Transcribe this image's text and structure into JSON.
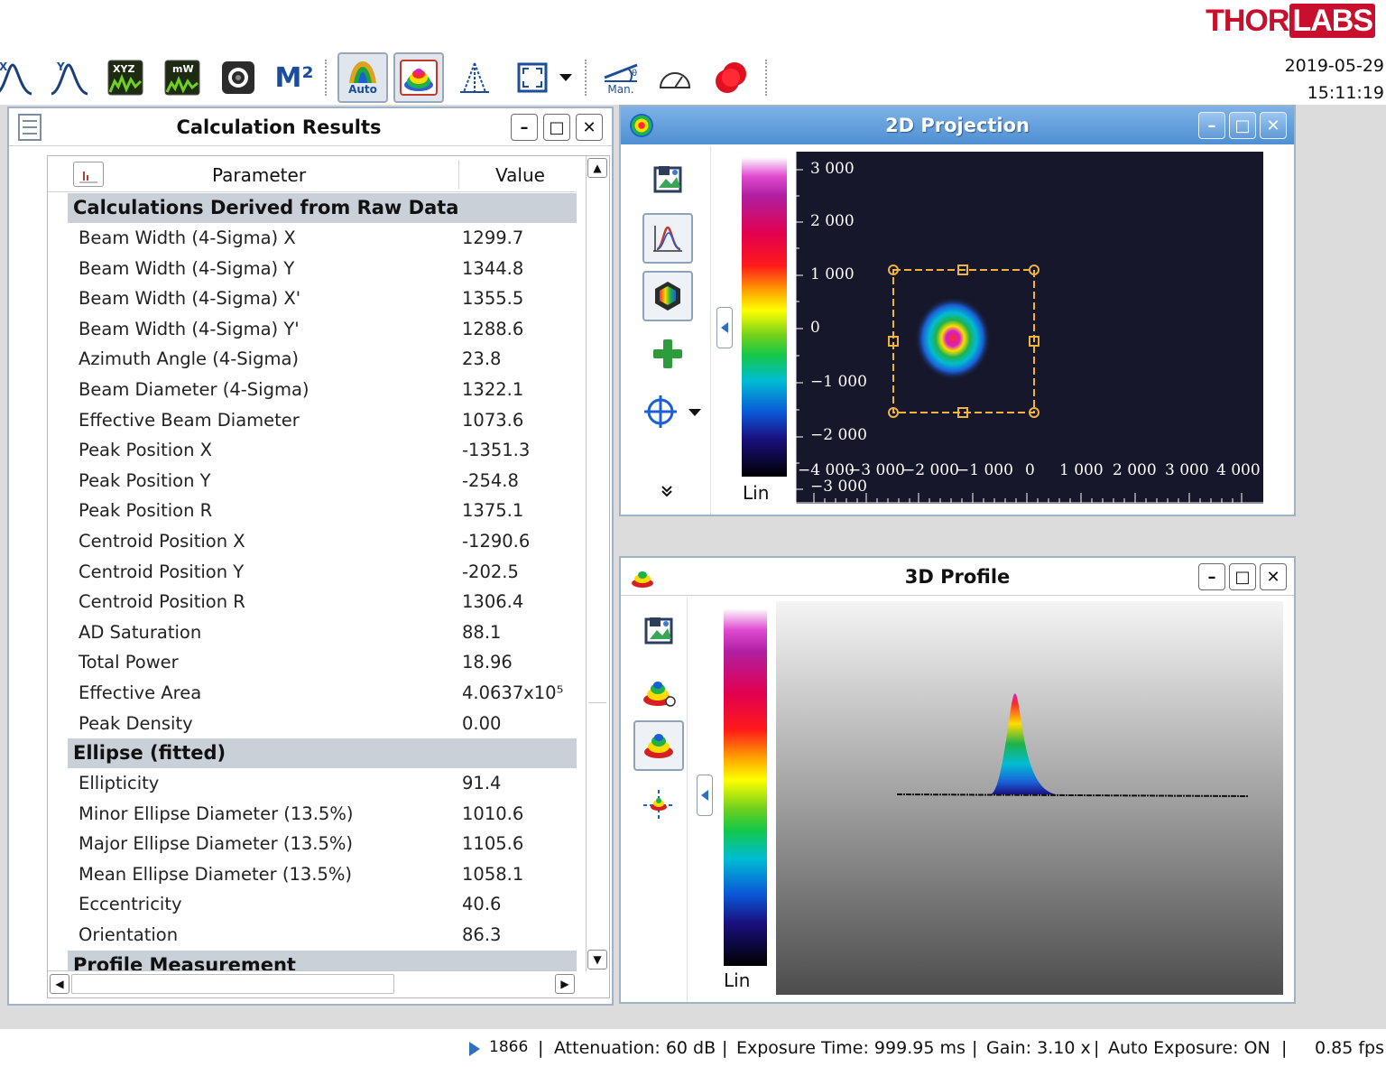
{
  "brand": {
    "name_a": "THOR",
    "name_b": "LABS"
  },
  "datetime": {
    "date": "2019-05-29",
    "time": "15:11:19"
  },
  "toolbar": {
    "m2_label": "M²",
    "auto_label": "Auto",
    "manual_label": "Man."
  },
  "calc_window": {
    "title": "Calculation Results",
    "col_parameter": "Parameter",
    "col_value": "Value",
    "sections": [
      {
        "heading": "Calculations Derived from Raw Data",
        "rows": [
          {
            "param": "Beam Width (4-Sigma) X",
            "value": "1299.7"
          },
          {
            "param": "Beam Width (4-Sigma) Y",
            "value": "1344.8"
          },
          {
            "param": "Beam Width (4-Sigma) X'",
            "value": "1355.5"
          },
          {
            "param": "Beam Width (4-Sigma) Y'",
            "value": "1288.6"
          },
          {
            "param": "Azimuth Angle (4-Sigma)",
            "value": "23.8"
          },
          {
            "param": "Beam Diameter (4-Sigma)",
            "value": "1322.1"
          },
          {
            "param": "Effective Beam Diameter",
            "value": "1073.6"
          },
          {
            "param": "Peak Position X",
            "value": "-1351.3"
          },
          {
            "param": "Peak Position Y",
            "value": "-254.8"
          },
          {
            "param": "Peak Position R",
            "value": "1375.1"
          },
          {
            "param": "Centroid Position X",
            "value": "-1290.6"
          },
          {
            "param": "Centroid Position Y",
            "value": "-202.5"
          },
          {
            "param": "Centroid Position R",
            "value": "1306.4"
          },
          {
            "param": "AD Saturation",
            "value": "88.1"
          },
          {
            "param": "Total Power",
            "value": "18.96"
          },
          {
            "param": "Effective Area",
            "value": "4.0637x10⁵"
          },
          {
            "param": "Peak Density",
            "value": "0.00"
          }
        ]
      },
      {
        "heading": "Ellipse (fitted)",
        "rows": [
          {
            "param": "Ellipticity",
            "value": "91.4"
          },
          {
            "param": "Minor Ellipse Diameter (13.5%)",
            "value": "1010.6"
          },
          {
            "param": "Major Ellipse Diameter (13.5%)",
            "value": "1105.6"
          },
          {
            "param": "Mean Ellipse Diameter (13.5%)",
            "value": "1058.1"
          },
          {
            "param": "Eccentricity",
            "value": "40.6"
          },
          {
            "param": "Orientation",
            "value": "86.3"
          }
        ]
      },
      {
        "heading": "Profile Measurement",
        "rows": []
      }
    ]
  },
  "projection_window": {
    "title": "2D Projection",
    "colorbar_label": "Lin",
    "y_ticks": [
      "3 000",
      "2 000",
      "1 000",
      "0",
      "−1 000",
      "−2 000",
      "−3 000"
    ],
    "x_ticks": [
      "−4 000",
      "−3 000",
      "−2 000",
      "−1 000",
      "0",
      "1 000",
      "2 000",
      "3 000",
      "4 000"
    ]
  },
  "profile_window": {
    "title": "3D Profile",
    "colorbar_label": "Lin"
  },
  "status": {
    "frame": "1866",
    "attenuation": "Attenuation: 60 dB",
    "exposure": "Exposure Time: 999.95 ms",
    "gain": "Gain: 3.10 x",
    "auto_exposure": "Auto Exposure: ON",
    "fps": "0.85 fps"
  },
  "colors": {
    "brand_red": "#c8102e",
    "titlebar_blue": "#4f8fd2",
    "section_gray": "#c9d0d8",
    "plot_bg": "#17172c"
  }
}
